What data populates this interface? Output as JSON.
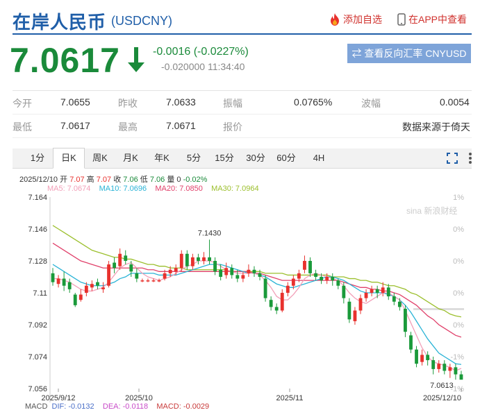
{
  "header": {
    "title": "在岸人民币",
    "code": "(USDCNY)",
    "fav_label": "添加自选",
    "app_label": "在APP中查看"
  },
  "quote": {
    "price": "7.0617",
    "change": "-0.0016 (-0.0227%)",
    "sub": "-0.020000 11:34:40",
    "reverse_label": "⇄ 查看反向汇率 CNYUSD"
  },
  "stats": {
    "open_label": "今开",
    "open": "7.0655",
    "prev_label": "昨收",
    "prev": "7.0633",
    "amp_label": "振幅",
    "amp": "0.0765%",
    "vol_label": "波幅",
    "vol": "0.0054",
    "low_label": "最低",
    "low": "7.0617",
    "high_label": "最高",
    "high": "7.0671",
    "report_label": "报价",
    "source": "数据来源于倚天"
  },
  "tabs": [
    "1分",
    "日K",
    "周K",
    "月K",
    "年K",
    "5分",
    "15分",
    "30分",
    "60分",
    "4H"
  ],
  "chart_info": {
    "line1": {
      "date": "2025/12/10",
      "o_l": "开",
      "o": "7.07",
      "h_l": "高",
      "h": "7.07",
      "c_l": "收",
      "c": "7.06",
      "l_l": "低",
      "l": "7.06",
      "v_l": "量",
      "v": "0",
      "p": "-0.02%"
    },
    "ma5": "MA5: 7.0674",
    "ma10": "MA10: 7.0696",
    "ma20": "MA20: 7.0850",
    "ma30": "MA30: 7.0964"
  },
  "chart_data": {
    "type": "candlestick",
    "ylim": [
      7.056,
      7.164
    ],
    "yticks": [
      "7.164",
      "7.146",
      "7.128",
      "7.11",
      "7.092",
      "7.074",
      "7.056"
    ],
    "pct_ticks": [
      "1%",
      "0%",
      "0%",
      "0%",
      "0%",
      "-1%",
      "-1%"
    ],
    "xticks": [
      "2025/9/12",
      "2025/10",
      "2025/11",
      "2025/12/10"
    ],
    "max_label": "7.1430",
    "min_label": "7.0613",
    "colors": {
      "up": "#e8312d",
      "down": "#1a9a3a",
      "ma5": "#f29fb8",
      "ma10": "#29b3d6",
      "ma20": "#e0406a",
      "ma30": "#9bbf2c"
    },
    "candles": [
      [
        7.121,
        7.116,
        7.124,
        7.114
      ],
      [
        7.115,
        7.118,
        7.12,
        7.113
      ],
      [
        7.118,
        7.114,
        7.122,
        7.111
      ],
      [
        7.116,
        7.112,
        7.118,
        7.11
      ],
      [
        7.109,
        7.103,
        7.11,
        7.102
      ],
      [
        7.106,
        7.109,
        7.112,
        7.105
      ],
      [
        7.11,
        7.114,
        7.116,
        7.108
      ],
      [
        7.113,
        7.115,
        7.117,
        7.111
      ],
      [
        7.116,
        7.114,
        7.118,
        7.112
      ],
      [
        7.112,
        7.113,
        7.116,
        7.11
      ],
      [
        7.114,
        7.126,
        7.128,
        7.113
      ],
      [
        7.127,
        7.124,
        7.13,
        7.121
      ],
      [
        7.125,
        7.132,
        7.135,
        7.123
      ],
      [
        7.131,
        7.128,
        7.134,
        7.126
      ],
      [
        7.126,
        7.122,
        7.128,
        7.119
      ],
      [
        7.121,
        7.118,
        7.124,
        7.116
      ],
      [
        7.117,
        7.117,
        7.118,
        7.116
      ],
      [
        7.117,
        7.117,
        7.118,
        7.116
      ],
      [
        7.117,
        7.117,
        7.118,
        7.116
      ],
      [
        7.117,
        7.117,
        7.118,
        7.116
      ],
      [
        7.118,
        7.121,
        7.123,
        7.117
      ],
      [
        7.121,
        7.123,
        7.125,
        7.119
      ],
      [
        7.122,
        7.124,
        7.126,
        7.12
      ],
      [
        7.124,
        7.132,
        7.134,
        7.122
      ],
      [
        7.132,
        7.125,
        7.134,
        7.123
      ],
      [
        7.125,
        7.13,
        7.132,
        7.123
      ],
      [
        7.13,
        7.128,
        7.132,
        7.126
      ],
      [
        7.128,
        7.13,
        7.133,
        7.126
      ],
      [
        7.13,
        7.128,
        7.14,
        7.126
      ],
      [
        7.128,
        7.122,
        7.13,
        7.12
      ],
      [
        7.123,
        7.119,
        7.126,
        7.117
      ],
      [
        7.12,
        7.124,
        7.127,
        7.118
      ],
      [
        7.124,
        7.12,
        7.126,
        7.118
      ],
      [
        7.12,
        7.118,
        7.123,
        7.116
      ],
      [
        7.118,
        7.12,
        7.122,
        7.116
      ],
      [
        7.121,
        7.123,
        7.126,
        7.119
      ],
      [
        7.123,
        7.121,
        7.125,
        7.119
      ],
      [
        7.121,
        7.119,
        7.123,
        7.117
      ],
      [
        7.118,
        7.107,
        7.12,
        7.105
      ],
      [
        7.106,
        7.102,
        7.108,
        7.1
      ],
      [
        7.102,
        7.1,
        7.104,
        7.098
      ],
      [
        7.1,
        7.11,
        7.112,
        7.099
      ],
      [
        7.11,
        7.114,
        7.116,
        7.108
      ],
      [
        7.114,
        7.118,
        7.12,
        7.112
      ],
      [
        7.118,
        7.121,
        7.123,
        7.116
      ],
      [
        7.123,
        7.128,
        7.131,
        7.121
      ],
      [
        7.128,
        7.121,
        7.13,
        7.119
      ],
      [
        7.121,
        7.119,
        7.123,
        7.117
      ],
      [
        7.119,
        7.117,
        7.121,
        7.115
      ],
      [
        7.117,
        7.119,
        7.121,
        7.115
      ],
      [
        7.119,
        7.117,
        7.121,
        7.114
      ],
      [
        7.117,
        7.114,
        7.118,
        7.112
      ],
      [
        7.114,
        7.107,
        7.116,
        7.104
      ],
      [
        7.105,
        7.095,
        7.107,
        7.093
      ],
      [
        7.094,
        7.1,
        7.102,
        7.092
      ],
      [
        7.1,
        7.107,
        7.109,
        7.098
      ],
      [
        7.107,
        7.11,
        7.112,
        7.105
      ],
      [
        7.11,
        7.112,
        7.114,
        7.108
      ],
      [
        7.112,
        7.11,
        7.114,
        7.107
      ],
      [
        7.11,
        7.113,
        7.116,
        7.108
      ],
      [
        7.113,
        7.108,
        7.115,
        7.106
      ],
      [
        7.108,
        7.105,
        7.11,
        7.103
      ],
      [
        7.105,
        7.102,
        7.107,
        7.1
      ],
      [
        7.101,
        7.088,
        7.103,
        7.085
      ],
      [
        7.086,
        7.078,
        7.088,
        7.076
      ],
      [
        7.078,
        7.07,
        7.08,
        7.068
      ],
      [
        7.071,
        7.075,
        7.078,
        7.069
      ],
      [
        7.075,
        7.072,
        7.077,
        7.069
      ],
      [
        7.072,
        7.067,
        7.074,
        7.064
      ],
      [
        7.067,
        7.07,
        7.072,
        7.065
      ],
      [
        7.07,
        7.066,
        7.072,
        7.064
      ],
      [
        7.066,
        7.068,
        7.07,
        7.062
      ],
      [
        7.068,
        7.064,
        7.07,
        7.061
      ],
      [
        7.064,
        7.061,
        7.066,
        7.0613
      ]
    ],
    "ma5": [
      7.118,
      7.118,
      7.117,
      7.116,
      7.114,
      7.112,
      7.111,
      7.111,
      7.112,
      7.113,
      7.116,
      7.12,
      7.124,
      7.126,
      7.127,
      7.124,
      7.121,
      7.119,
      7.118,
      7.117,
      7.118,
      7.119,
      7.121,
      7.123,
      7.125,
      7.126,
      7.128,
      7.128,
      7.128,
      7.127,
      7.125,
      7.123,
      7.122,
      7.121,
      7.121,
      7.121,
      7.121,
      7.12,
      7.117,
      7.113,
      7.108,
      7.106,
      7.106,
      7.109,
      7.113,
      7.118,
      7.12,
      7.121,
      7.12,
      7.119,
      7.118,
      7.117,
      7.114,
      7.11,
      7.107,
      7.105,
      7.104,
      7.106,
      7.108,
      7.11,
      7.11,
      7.108,
      7.106,
      7.1,
      7.093,
      7.086,
      7.079,
      7.074,
      7.071,
      7.07,
      7.069,
      7.068,
      7.066,
      7.0674
    ],
    "ma10": [
      7.126,
      7.124,
      7.122,
      7.12,
      7.118,
      7.116,
      7.115,
      7.114,
      7.114,
      7.114,
      7.115,
      7.116,
      7.118,
      7.119,
      7.121,
      7.121,
      7.121,
      7.121,
      7.121,
      7.12,
      7.12,
      7.12,
      7.12,
      7.121,
      7.122,
      7.123,
      7.124,
      7.125,
      7.126,
      7.126,
      7.126,
      7.125,
      7.124,
      7.123,
      7.122,
      7.121,
      7.121,
      7.12,
      7.119,
      7.117,
      7.115,
      7.114,
      7.113,
      7.113,
      7.114,
      7.115,
      7.116,
      7.117,
      7.118,
      7.119,
      7.119,
      7.118,
      7.117,
      7.115,
      7.113,
      7.111,
      7.11,
      7.11,
      7.11,
      7.11,
      7.109,
      7.108,
      7.106,
      7.103,
      7.099,
      7.094,
      7.089,
      7.084,
      7.08,
      7.076,
      7.074,
      7.072,
      7.07,
      7.0696
    ],
    "ma20": [
      7.138,
      7.136,
      7.134,
      7.132,
      7.13,
      7.128,
      7.127,
      7.126,
      7.125,
      7.124,
      7.124,
      7.124,
      7.124,
      7.124,
      7.124,
      7.124,
      7.124,
      7.123,
      7.123,
      7.122,
      7.122,
      7.122,
      7.122,
      7.122,
      7.122,
      7.122,
      7.122,
      7.122,
      7.122,
      7.122,
      7.122,
      7.122,
      7.122,
      7.122,
      7.122,
      7.122,
      7.121,
      7.121,
      7.12,
      7.119,
      7.118,
      7.117,
      7.117,
      7.117,
      7.117,
      7.117,
      7.117,
      7.117,
      7.117,
      7.117,
      7.117,
      7.117,
      7.116,
      7.115,
      7.114,
      7.113,
      7.113,
      7.112,
      7.112,
      7.111,
      7.111,
      7.11,
      7.109,
      7.107,
      7.105,
      7.103,
      7.1,
      7.097,
      7.095,
      7.092,
      7.09,
      7.088,
      7.086,
      7.085
    ],
    "ma30": [
      7.148,
      7.146,
      7.144,
      7.142,
      7.14,
      7.138,
      7.136,
      7.134,
      7.133,
      7.132,
      7.131,
      7.13,
      7.13,
      7.129,
      7.129,
      7.128,
      7.127,
      7.126,
      7.126,
      7.125,
      7.125,
      7.124,
      7.124,
      7.124,
      7.123,
      7.123,
      7.123,
      7.123,
      7.123,
      7.123,
      7.123,
      7.123,
      7.122,
      7.122,
      7.122,
      7.122,
      7.122,
      7.122,
      7.121,
      7.121,
      7.121,
      7.121,
      7.12,
      7.12,
      7.12,
      7.12,
      7.12,
      7.12,
      7.12,
      7.12,
      7.119,
      7.119,
      7.119,
      7.118,
      7.118,
      7.117,
      7.117,
      7.116,
      7.116,
      7.115,
      7.114,
      7.114,
      7.113,
      7.112,
      7.11,
      7.109,
      7.107,
      7.105,
      7.103,
      7.101,
      7.1,
      7.098,
      7.097,
      7.0964
    ]
  },
  "macd": {
    "label": "MACD",
    "dif": "DIF: -0.0132",
    "dea": "DEA: -0.0118",
    "macd": "MACD: -0.0029"
  }
}
